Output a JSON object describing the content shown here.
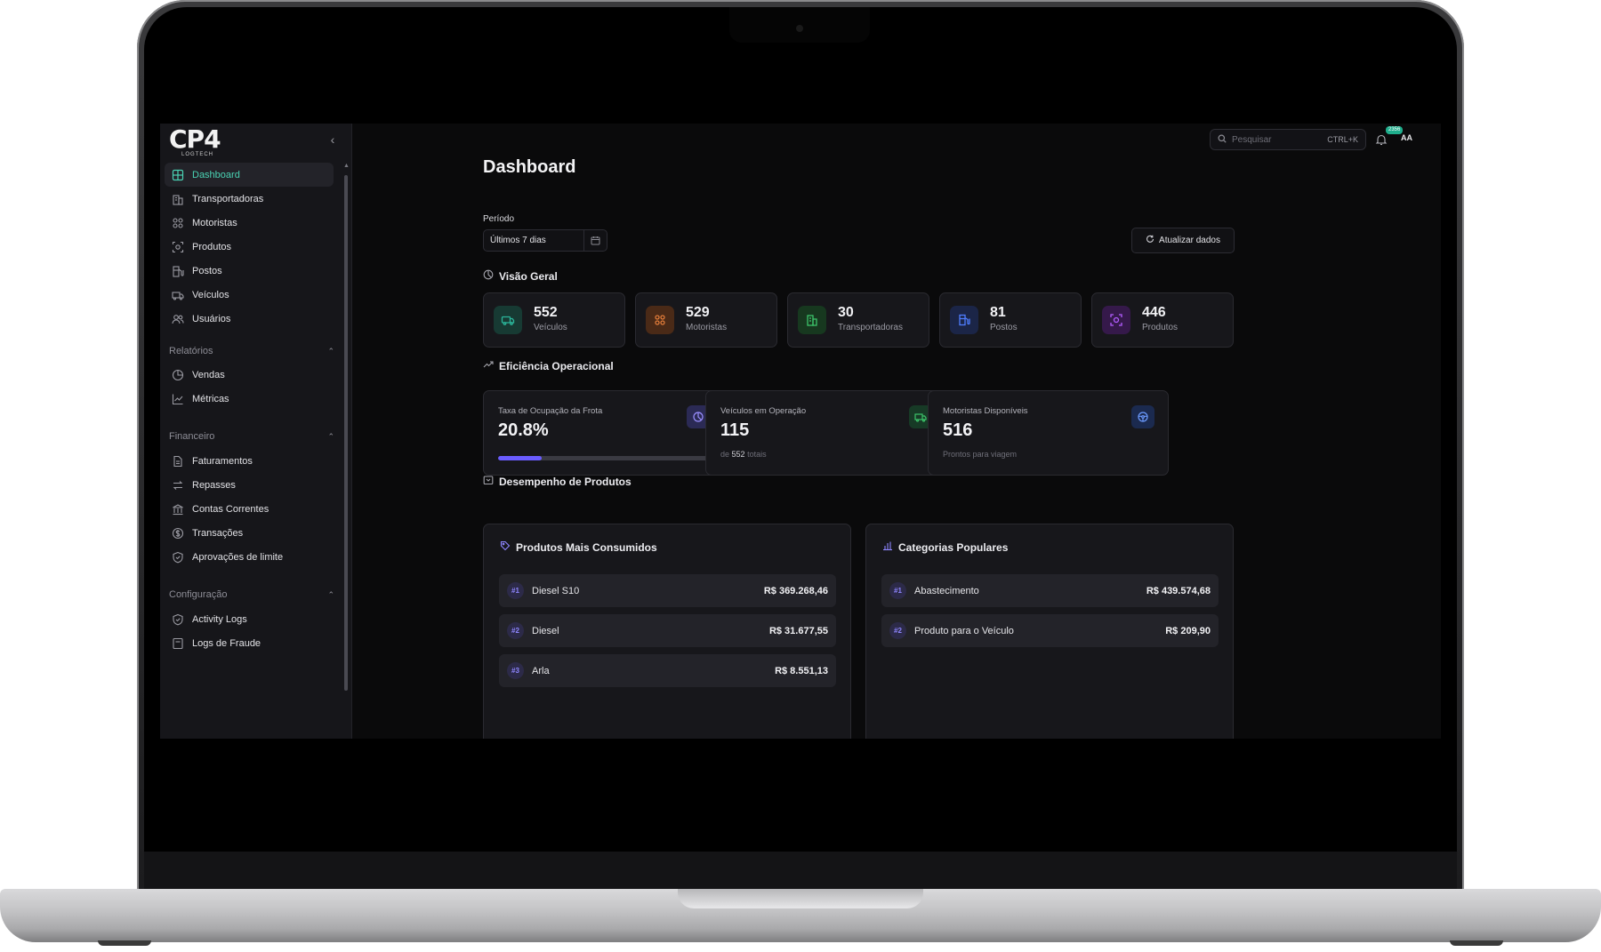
{
  "app": {
    "logo_text": "CP4",
    "logo_subtext": "LOGTECH"
  },
  "sidebar": {
    "items": [
      {
        "label": "Dashboard",
        "icon": "grid-icon",
        "active": true
      },
      {
        "label": "Transportadoras",
        "icon": "building-icon"
      },
      {
        "label": "Motoristas",
        "icon": "users-grid-icon"
      },
      {
        "label": "Produtos",
        "icon": "scan-icon"
      },
      {
        "label": "Postos",
        "icon": "fuel-icon"
      },
      {
        "label": "Veículos",
        "icon": "truck-icon"
      },
      {
        "label": "Usuários",
        "icon": "user-group-icon"
      }
    ],
    "sections": [
      {
        "title": "Relatórios",
        "items": [
          {
            "label": "Vendas",
            "icon": "chart-pie-icon"
          },
          {
            "label": "Métricas",
            "icon": "line-chart-icon"
          }
        ]
      },
      {
        "title": "Financeiro",
        "items": [
          {
            "label": "Faturamentos",
            "icon": "file-icon"
          },
          {
            "label": "Repasses",
            "icon": "transfer-icon"
          },
          {
            "label": "Contas Correntes",
            "icon": "bank-icon"
          },
          {
            "label": "Transações",
            "icon": "coin-icon"
          },
          {
            "label": "Aprovações de limite",
            "icon": "shield-check-icon"
          }
        ]
      },
      {
        "title": "Configuração",
        "items": [
          {
            "label": "Activity Logs",
            "icon": "shield-icon"
          },
          {
            "label": "Logs de Fraude",
            "icon": "log-icon"
          }
        ]
      }
    ]
  },
  "topbar": {
    "search_placeholder": "Pesquisar",
    "search_shortcut": "CTRL+K",
    "notification_count": "2356",
    "avatar_initials": "AA"
  },
  "main": {
    "title": "Dashboard",
    "period_label": "Período",
    "period_value": "Últimos 7 dias",
    "refresh_label": "Atualizar dados",
    "overview": {
      "title": "Visão Geral",
      "cards": [
        {
          "value": "552",
          "label": "Veículos",
          "icon": "truck-icon",
          "color": "#2bb59a"
        },
        {
          "value": "529",
          "label": "Motoristas",
          "icon": "users-grid-icon",
          "color": "#e07b39"
        },
        {
          "value": "30",
          "label": "Transportadoras",
          "icon": "building-icon",
          "color": "#3cc36a"
        },
        {
          "value": "81",
          "label": "Postos",
          "icon": "fuel-icon",
          "color": "#4f7dff"
        },
        {
          "value": "446",
          "label": "Produtos",
          "icon": "scan-icon",
          "color": "#b25dff"
        }
      ]
    },
    "efficiency": {
      "title": "Eficiência Operacional",
      "cards": [
        {
          "label": "Taxa de Ocupação da Frota",
          "value": "20.8%",
          "progress": 0.208,
          "icon": "pie-icon"
        },
        {
          "label": "Veículos em Operação",
          "value": "115",
          "sub_prefix": "de",
          "sub_value": "552",
          "sub_suffix": "totais",
          "icon": "truck-icon"
        },
        {
          "label": "Motoristas Disponíveis",
          "value": "516",
          "sub_text": "Prontos para viagem",
          "icon": "steering-icon"
        }
      ]
    },
    "products": {
      "title": "Desempenho de Produtos",
      "most_consumed": {
        "title": "Produtos Mais Consumidos",
        "rows": [
          {
            "rank": "#1",
            "name": "Diesel S10",
            "value": "R$ 369.268,46"
          },
          {
            "rank": "#2",
            "name": "Diesel",
            "value": "R$ 31.677,55"
          },
          {
            "rank": "#3",
            "name": "Arla",
            "value": "R$ 8.551,13"
          }
        ]
      },
      "popular_categories": {
        "title": "Categorias Populares",
        "rows": [
          {
            "rank": "#1",
            "name": "Abastecimento",
            "value": "R$ 439.574,68"
          },
          {
            "rank": "#2",
            "name": "Produto para o Veículo",
            "value": "R$ 209,90"
          }
        ]
      }
    }
  },
  "colors": {
    "accent": "#4ad3b4",
    "progress": "#6a5cff",
    "background": "#0a0a0b",
    "card": "#17171b"
  }
}
